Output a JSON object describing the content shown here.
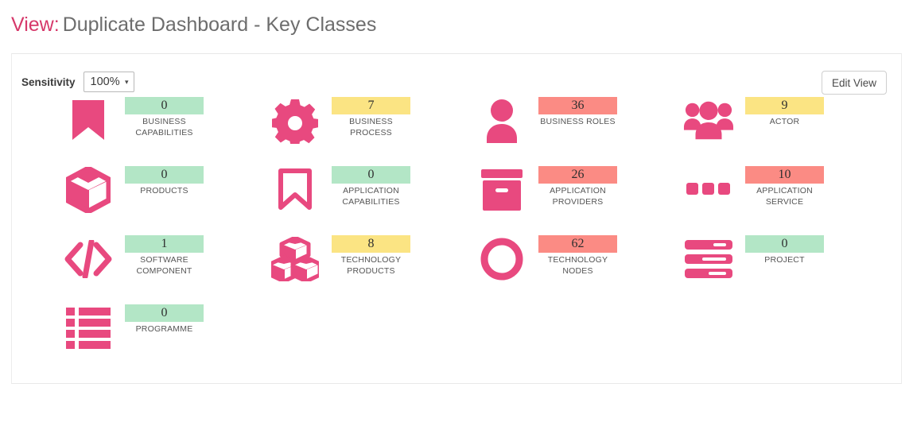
{
  "header": {
    "view_label": "View:",
    "view_title": "Duplicate Dashboard - Key Classes",
    "label_color": "#d6386a",
    "title_color": "#6d6d6d"
  },
  "toolbar": {
    "sensitivity_label": "Sensitivity",
    "sensitivity_value": "100%",
    "sensitivity_caret": "▾",
    "edit_view_label": "Edit View"
  },
  "palette": {
    "icon_pink": "#e8497f",
    "badge_green": "#b3e6c6",
    "badge_yellow": "#fbe483",
    "badge_red": "#fb8b84"
  },
  "tiles": [
    {
      "icon": "bookmark-filled-icon",
      "count": "0",
      "label": "Business Capabilities",
      "status": "green"
    },
    {
      "icon": "gear-icon",
      "count": "7",
      "label": "Business Process",
      "status": "yellow"
    },
    {
      "icon": "person-icon",
      "count": "36",
      "label": "Business Roles",
      "status": "red"
    },
    {
      "icon": "people-group-icon",
      "count": "9",
      "label": "Actor",
      "status": "yellow"
    },
    {
      "icon": "cube-icon",
      "count": "0",
      "label": "Products",
      "status": "green"
    },
    {
      "icon": "bookmark-outline-icon",
      "count": "0",
      "label": "Application Capabilities",
      "status": "green"
    },
    {
      "icon": "archive-box-icon",
      "count": "26",
      "label": "Application Providers",
      "status": "red"
    },
    {
      "icon": "three-dots-icon",
      "count": "10",
      "label": "Application Service",
      "status": "red"
    },
    {
      "icon": "code-brackets-icon",
      "count": "1",
      "label": "Software Component",
      "status": "green"
    },
    {
      "icon": "stacked-cubes-icon",
      "count": "8",
      "label": "Technology Products",
      "status": "yellow"
    },
    {
      "icon": "circle-ring-icon",
      "count": "62",
      "label": "Technology Nodes",
      "status": "red"
    },
    {
      "icon": "server-bars-icon",
      "count": "0",
      "label": "Project",
      "status": "green"
    },
    {
      "icon": "list-bullets-icon",
      "count": "0",
      "label": "Programme",
      "status": "green"
    }
  ]
}
